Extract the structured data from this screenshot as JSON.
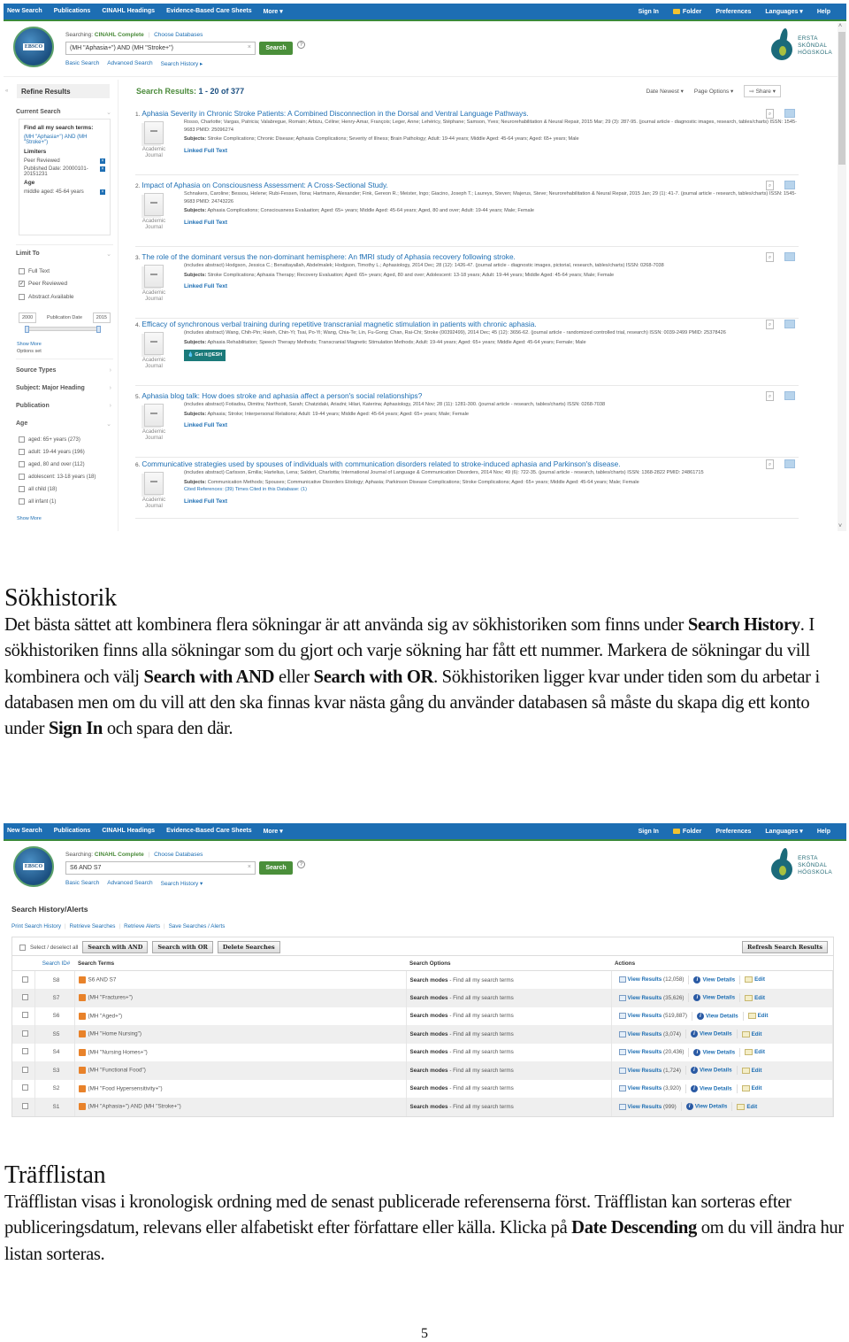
{
  "app": {
    "nav_left": [
      "New Search",
      "Publications",
      "CINAHL Headings",
      "Evidence-Based Care Sheets",
      "More ▾"
    ],
    "nav_right": [
      "Sign In",
      "Folder",
      "Preferences",
      "Languages ▾",
      "Help"
    ],
    "logo_text": "EBSCO",
    "searching_label": "Searching:",
    "database": "CINAHL Complete",
    "choose_databases": "Choose Databases",
    "search_button": "Search",
    "help_glyph": "?",
    "clear_glyph": "×",
    "sub_links": [
      "Basic Search",
      "Advanced Search",
      "Search History ▸"
    ],
    "sub_links_2": [
      "Basic Search",
      "Advanced Search",
      "Search History ▾"
    ],
    "institution": [
      "ERSTA",
      "SKÖNDAL",
      "HÖGSKOLA"
    ]
  },
  "screenshot1": {
    "search_query": "(MH \"Aphasia+\") AND (MH \"Stroke+\")",
    "sidebar": {
      "collapse_glyph": "«",
      "refine_title": "Refine Results",
      "current_search": "Current Search",
      "find_all_label": "Find all my search terms:",
      "find_all_terms": "(MH \"Aphasia+\") AND (MH \"Stroke+\")",
      "limiters_label": "Limiters",
      "limiters": [
        "Peer Reviewed",
        "Published Date: 20000101-20151231"
      ],
      "age_label": "Age",
      "age_limiter": "middle aged: 45-64 years",
      "limit_to": "Limit To",
      "limit_options": [
        {
          "label": "Full Text",
          "checked": false
        },
        {
          "label": "Peer Reviewed",
          "checked": true
        },
        {
          "label": "Abstract Available",
          "checked": false
        }
      ],
      "date_from": "2000",
      "date_label": "Publication Date",
      "date_to": "2015",
      "show_more": "Show More",
      "options_set": "Options set",
      "facets": [
        "Source Types",
        "Subject: Major Heading",
        "Publication",
        "Age"
      ],
      "age_options": [
        "aged: 65+ years (273)",
        "adult: 19-44 years (196)",
        "aged, 80 and over (112)",
        "adolescent: 13-18 years (18)",
        "all child (18)",
        "all infant (1)"
      ],
      "age_show_more": "Show More"
    },
    "results_label": "Search Results:",
    "results_range": "1 - 20 of 377",
    "toolbar": {
      "sort": "Date Newest ▾",
      "page_options": "Page Options ▾",
      "share": "⇨ Share ▾"
    },
    "results": [
      {
        "num": "1.",
        "title": "Aphasia Severity in Chronic Stroke Patients: A Combined Disconnection in the Dorsal and Ventral Language Pathways.",
        "citation": "Rosso, Charlotte; Vargas, Patricia; Valabregue, Romain; Arbizu, Céline; Henry-Amar, François; Leger, Anne; Lehéricy, Stéphane; Samson, Yves; Neurorehabilitation & Neural Repair, 2015 Mar; 29 (3): 287-95. (journal article - diagnostic images, research, tables/charts) ISSN: 1545-9683 PMID: 25096274",
        "subjects_label": "Subjects:",
        "subjects": "Stroke Complications; Chronic Disease; Aphasia Complications; Severity of Illness; Brain Pathology; Adult: 19-44 years; Middle Aged: 45-64 years; Aged: 65+ years; Male",
        "type": "Academic Journal",
        "link": "Linked Full Text"
      },
      {
        "num": "2.",
        "title": "Impact of Aphasia on Consciousness Assessment: A Cross-Sectional Study.",
        "citation": "Schnakers, Caroline; Bessou, Helene; Rubi-Fessen, Ilona; Hartmann, Alexander; Fink, Gereon R.; Meister, Ingo; Giacino, Joseph T.; Laureys, Steven; Majerus, Steve; Neurorehabilitation & Neural Repair, 2015 Jan; 29 (1): 41-7. (journal article - research, tables/charts) ISSN: 1545-9683 PMID: 24743226",
        "subjects_label": "Subjects:",
        "subjects": "Aphasia Complications; Consciousness Evaluation; Aged: 65+ years; Middle Aged: 45-64 years; Aged, 80 and over; Adult: 19-44 years; Male; Female",
        "type": "Academic Journal",
        "link": "Linked Full Text"
      },
      {
        "num": "3.",
        "title": "The role of the dominant versus the non-dominant hemisphere: An fMRI study of Aphasia recovery following stroke.",
        "citation": "(includes abstract) Hodgson, Jessica C.; Benattayallah, Abdelmalek; Hodgson, Timothy L.; Aphasiology, 2014 Dec; 28 (12): 1426-47. (journal article - diagnostic images, pictorial, research, tables/charts) ISSN: 0268-7038",
        "subjects_label": "Subjects:",
        "subjects": "Stroke Complications; Aphasia Therapy; Recovery Evaluation; Aged: 65+ years; Aged, 80 and over; Adolescent: 13-18 years; Adult: 19-44 years; Middle Aged: 45-64 years; Male; Female",
        "type": "Academic Journal",
        "link": "Linked Full Text"
      },
      {
        "num": "4.",
        "title": "Efficacy of synchronous verbal training during repetitive transcranial magnetic stimulation in patients with chronic aphasia.",
        "citation": "(includes abstract) Wang, Chih-Pin; Hsieh, Chin-Yi; Tsai, Po-Yi; Wang, Chia-Te; Lin, Fu-Gong; Chan, Rai-Chi; Stroke (00392499), 2014 Dec; 45 (12): 3656-62. (journal article - randomized controlled trial, research) ISSN: 0039-2499 PMID: 25378426",
        "subjects_label": "Subjects:",
        "subjects": "Aphasia Rehabilitation; Speech Therapy Methods; Transcranial Magnetic Stimulation Methods; Adult: 19-44 years; Aged: 65+ years; Middle Aged: 45-64 years; Female; Male",
        "type": "Academic Journal",
        "getit": "Get it@ESH"
      },
      {
        "num": "5.",
        "title": "Aphasia blog talk: How does stroke and aphasia affect a person's social relationships?",
        "citation": "(includes abstract) Fotiadou, Dimitra; Northcott, Sarah; Chatzidaki, Ariadni; Hilari, Katerina; Aphasiology, 2014 Nov; 28 (11): 1281-300. (journal article - research, tables/charts) ISSN: 0268-7038",
        "subjects_label": "Subjects:",
        "subjects": "Aphasia; Stroke; Interpersonal Relations; Adult: 19-44 years; Middle Aged: 45-64 years; Aged: 65+ years; Male; Female",
        "type": "Academic Journal",
        "link": "Linked Full Text"
      },
      {
        "num": "6.",
        "title": "Communicative strategies used by spouses of individuals with communication disorders related to stroke-induced aphasia and Parkinson's disease.",
        "citation": "(includes abstract) Carlsson, Emilia; Hartelius, Lena; Saldert, Charlotta; International Journal of Language & Communication Disorders, 2014 Nov; 49 (6): 722-35. (journal article - research, tables/charts) ISSN: 1368-2822 PMID: 24861715",
        "subjects_label": "Subjects:",
        "subjects": "Communication Methods; Spouses; Communicative Disorders Etiology; Aphasia; Parkinson Disease Complications; Stroke Complications; Aged: 65+ years; Middle Aged: 45-64 years; Male; Female",
        "cited": "Cited References: (39) Times Cited in this Database: (1)",
        "type": "Academic Journal",
        "link": "Linked Full Text"
      }
    ]
  },
  "screenshot2": {
    "search_query": "S6 AND S7",
    "title": "Search History/Alerts",
    "links": [
      "Print Search History",
      "Retrieve Searches",
      "Retrieve Alerts",
      "Save Searches / Alerts"
    ],
    "select_all": "Select / deselect all",
    "buttons": {
      "and": "Search with AND",
      "or": "Search with OR",
      "delete": "Delete Searches",
      "refresh": "Refresh Search Results"
    },
    "columns": [
      "Search ID#",
      "Search Terms",
      "Search Options",
      "Actions"
    ],
    "rows": [
      {
        "id": "S8",
        "terms": "S6 AND S7",
        "mode": "Search modes",
        "mode_desc": "- Find all my search terms",
        "count": "(12,058)"
      },
      {
        "id": "S7",
        "terms": "(MH \"Fractures+\")",
        "mode": "Search modes",
        "mode_desc": "- Find all my search terms",
        "count": "(35,626)"
      },
      {
        "id": "S6",
        "terms": "(MH \"Aged+\")",
        "mode": "Search modes",
        "mode_desc": "- Find all my search terms",
        "count": "(519,887)"
      },
      {
        "id": "S5",
        "terms": "(MH \"Home Nursing\")",
        "mode": "Search modes",
        "mode_desc": "- Find all my search terms",
        "count": "(3,074)"
      },
      {
        "id": "S4",
        "terms": "(MH \"Nursing Homes+\")",
        "mode": "Search modes",
        "mode_desc": "- Find all my search terms",
        "count": "(20,436)"
      },
      {
        "id": "S3",
        "terms": "(MH \"Functional Food\")",
        "mode": "Search modes",
        "mode_desc": "- Find all my search terms",
        "count": "(1,724)"
      },
      {
        "id": "S2",
        "terms": "(MH \"Food Hypersensitivity+\")",
        "mode": "Search modes",
        "mode_desc": "- Find all my search terms",
        "count": "(3,920)"
      },
      {
        "id": "S1",
        "terms": "(MH \"Aphasia+\") AND (MH \"Stroke+\")",
        "mode": "Search modes",
        "mode_desc": "- Find all my search terms",
        "count": "(999)"
      }
    ],
    "action_labels": {
      "view_results": "View Results",
      "view_details": "View Details",
      "edit": "Edit"
    }
  },
  "document": {
    "section1_heading": "Sökhistorik",
    "section1_parts": [
      {
        "t": "Det bästa sättet att kombinera flera sökningar är att använda sig av sökhistoriken som finns under ",
        "b": false
      },
      {
        "t": "Search History",
        "b": true
      },
      {
        "t": ". I sökhistoriken finns alla sökningar som du gjort och varje sökning har fått ett nummer. Markera de sökningar du vill kombinera och välj ",
        "b": false
      },
      {
        "t": "Search with AND",
        "b": true
      },
      {
        "t": " eller ",
        "b": false
      },
      {
        "t": "Search with OR",
        "b": true
      },
      {
        "t": ". Sökhistoriken ligger kvar under tiden som du arbetar i databasen men om du vill att den ska finnas kvar nästa gång du använder databasen så måste du skapa dig ett konto under ",
        "b": false
      },
      {
        "t": "Sign In",
        "b": true
      },
      {
        "t": " och spara den där.",
        "b": false
      }
    ],
    "section2_heading": "Träfflistan",
    "section2_parts": [
      {
        "t": "Träfflistan visas i kronologisk ordning med de senast publicerade referenserna först. Träfflistan kan sorteras efter publiceringsdatum, relevans eller alfabetiskt efter författare eller källa. Klicka på ",
        "b": false
      },
      {
        "t": "Date Descending",
        "b": true
      },
      {
        "t": " om du vill ändra hur listan sorteras.",
        "b": false
      }
    ],
    "page_number": "5"
  }
}
